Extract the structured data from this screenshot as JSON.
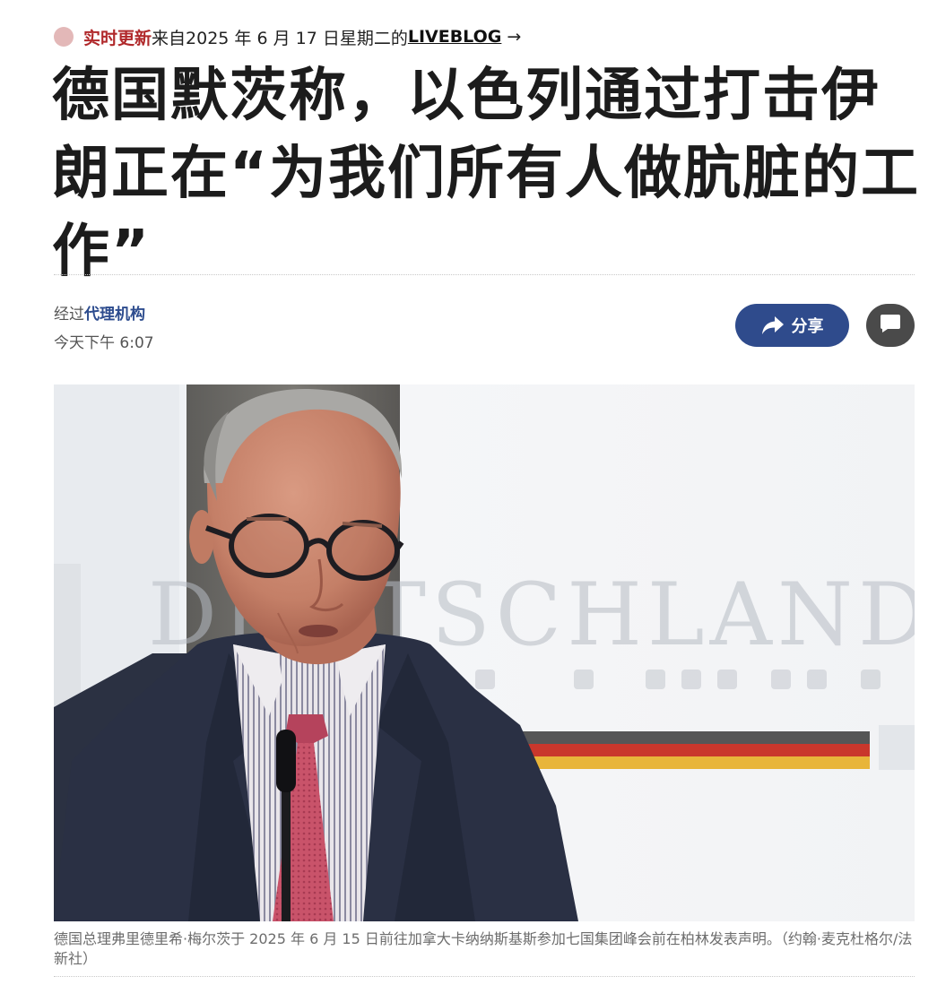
{
  "live": {
    "label": "实时更新",
    "text": "来自2025 年 6 月 17 日星期二的",
    "link": "LIVEBLOG",
    "arrow": "→"
  },
  "headline": "德国默茨称，以色列通过打击伊朗正在“为我们所有人做肮脏的工作”",
  "byline": {
    "prefix": "经过",
    "source": "代理机构",
    "timestamp": "今天下午 6:07"
  },
  "actions": {
    "share_label": "分享",
    "share_icon": "share-arrow-icon",
    "comment_icon": "comment-bubble-icon"
  },
  "photo": {
    "backdrop_text": "DEUTSCHLAND"
  },
  "caption": "德国总理弗里德里希·梅尔茨于 2025 年 6 月 15 日前往加拿大卡纳纳斯基斯参加七国集团峰会前在柏林发表声明。（约翰·麦克杜格尔/法新社）",
  "colors": {
    "live_red": "#b0282a",
    "live_dot": "#e3b8b8",
    "share_blue": "#2f4b8c",
    "comment_grey": "#4a4a4a",
    "byline_link": "#2d4c8e"
  }
}
